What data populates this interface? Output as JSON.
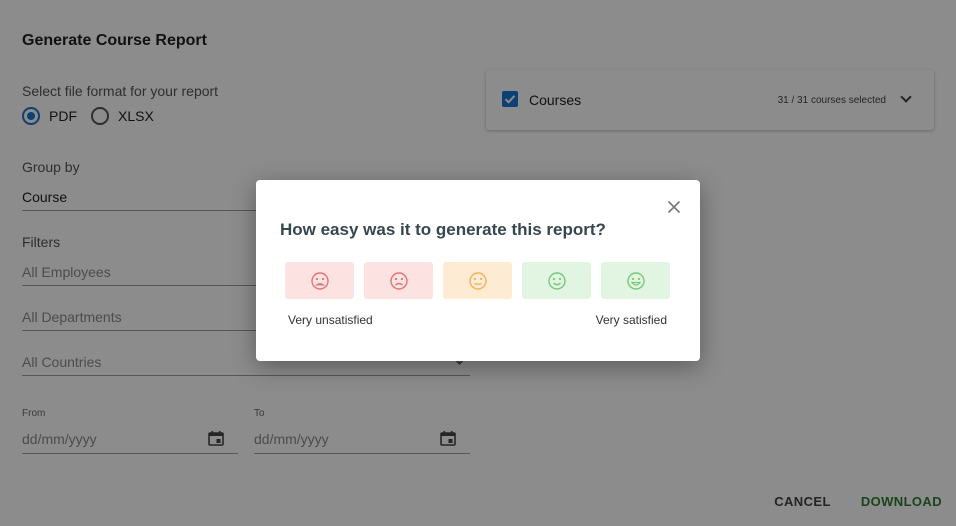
{
  "report": {
    "title": "Generate Course Report",
    "format_label": "Select file format for your report",
    "formats": [
      {
        "label": "PDF",
        "selected": true
      },
      {
        "label": "XLSX",
        "selected": false
      }
    ],
    "group_by_label": "Group by",
    "group_by_value": "Course",
    "filters_label": "Filters",
    "filter_employees": "All Employees",
    "filter_departments": "All Departments",
    "filter_countries": "All Countries",
    "from_label": "From",
    "from_placeholder": "dd/mm/yyyy",
    "to_label": "To",
    "to_placeholder": "dd/mm/yyyy",
    "courses_label": "Courses",
    "courses_checked": true,
    "courses_count": "31 / 31 courses selected"
  },
  "actions": {
    "cancel": "CANCEL",
    "download": "DOWNLOAD"
  },
  "feedback": {
    "question": "How easy was it to generate this report?",
    "scale_min_label": "Very unsatisfied",
    "scale_max_label": "Very satisfied",
    "options": [
      {
        "icon": "very-sad-face-icon",
        "bg": "#fde2e2",
        "color": "#e57373"
      },
      {
        "icon": "sad-face-icon",
        "bg": "#fde2e2",
        "color": "#e57373"
      },
      {
        "icon": "neutral-face-icon",
        "bg": "#fdebd3",
        "color": "#f0b35a"
      },
      {
        "icon": "smile-face-icon",
        "bg": "#e2f5e2",
        "color": "#77c97a"
      },
      {
        "icon": "very-happy-face-icon",
        "bg": "#e2f5e2",
        "color": "#77c97a"
      }
    ]
  },
  "colors": {
    "accent": "#1976d2",
    "download": "#2e7d32",
    "overlay": "rgba(0,0,0,0.45)"
  }
}
